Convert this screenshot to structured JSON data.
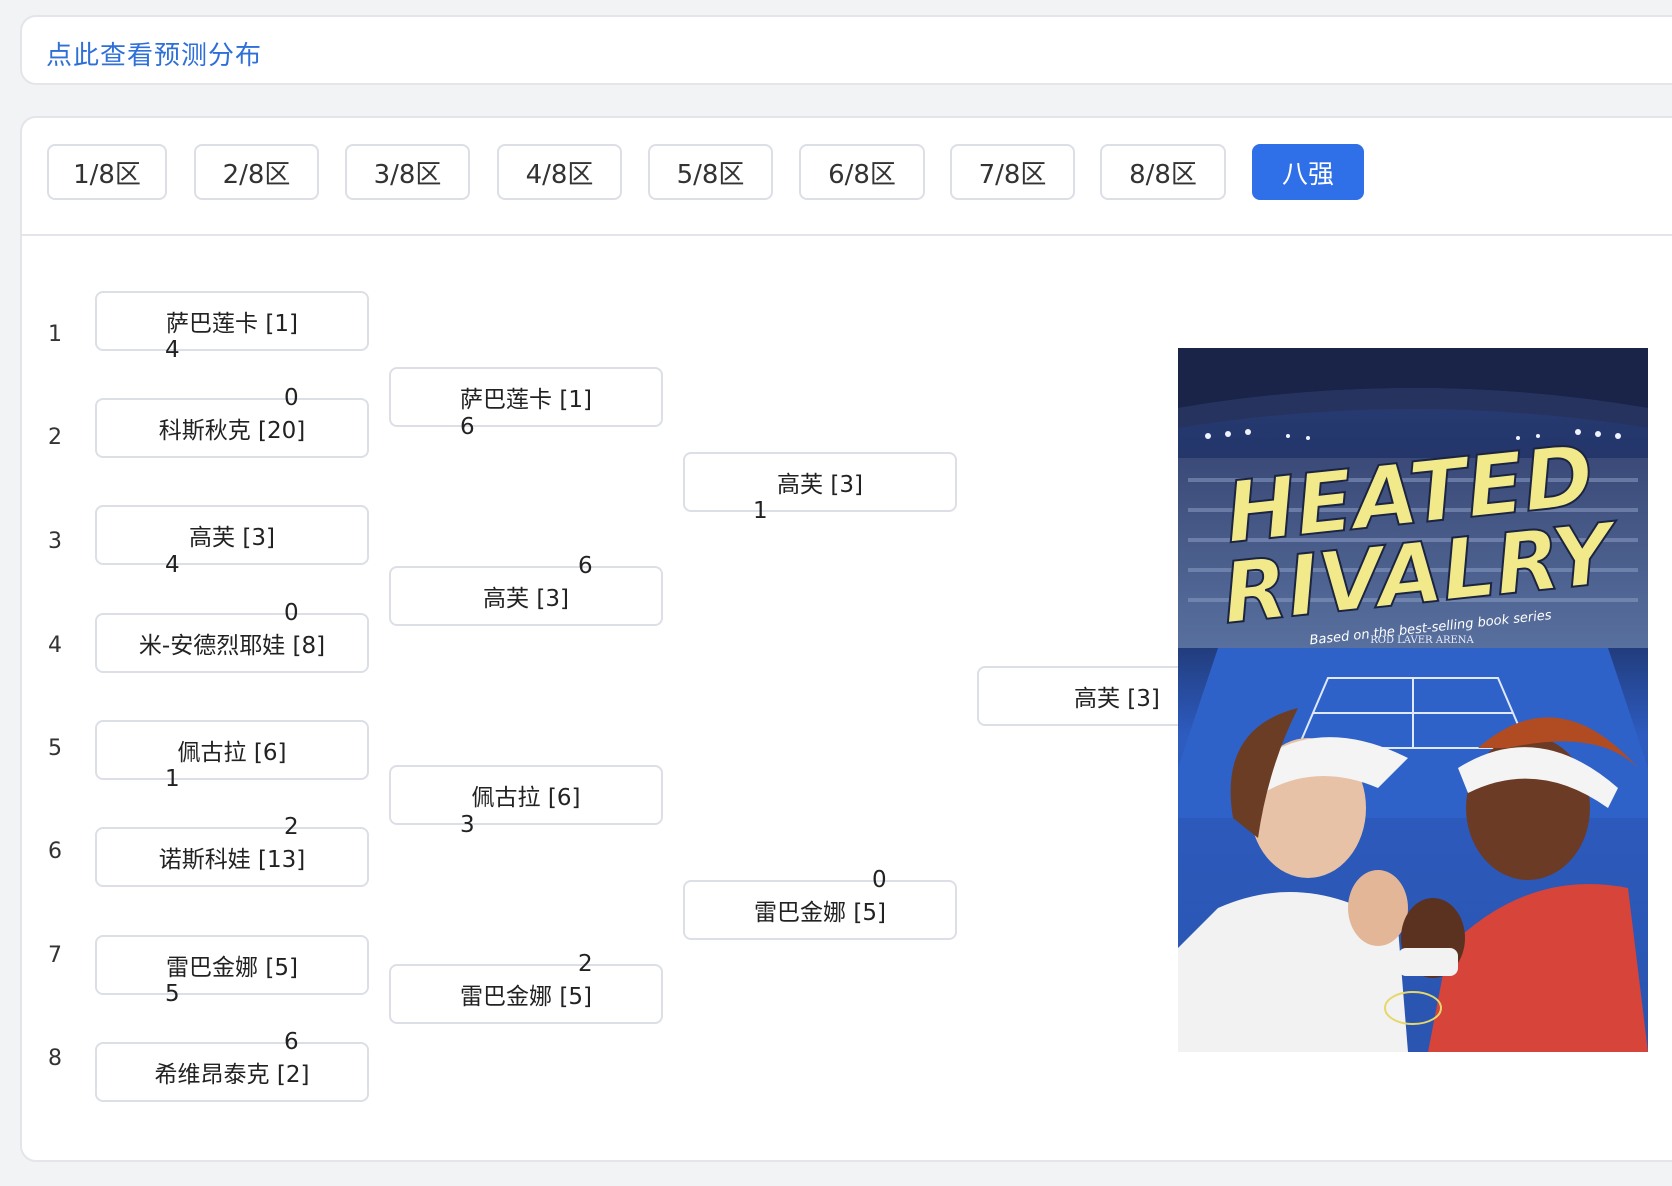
{
  "top": {
    "link_text": "点此查看预测分布"
  },
  "tabs": [
    {
      "label": "1/8区",
      "active": false
    },
    {
      "label": "2/8区",
      "active": false
    },
    {
      "label": "3/8区",
      "active": false
    },
    {
      "label": "4/8区",
      "active": false
    },
    {
      "label": "5/8区",
      "active": false
    },
    {
      "label": "6/8区",
      "active": false
    },
    {
      "label": "7/8区",
      "active": false
    },
    {
      "label": "8/8区",
      "active": false
    },
    {
      "label": "八强",
      "active": true
    }
  ],
  "rows": [
    "1",
    "2",
    "3",
    "4",
    "5",
    "6",
    "7",
    "8"
  ],
  "round1": [
    {
      "player": "萨巴莲卡 [1]",
      "score": "4"
    },
    {
      "player": "科斯秋克 [20]",
      "score": "0"
    },
    {
      "player": "高芙 [3]",
      "score": "4"
    },
    {
      "player": "米-安德烈耶娃 [8]",
      "score": "0"
    },
    {
      "player": "佩古拉 [6]",
      "score": "1"
    },
    {
      "player": "诺斯科娃 [13]",
      "score": "2"
    },
    {
      "player": "雷巴金娜 [5]",
      "score": "5"
    },
    {
      "player": "希维昂泰克 [2]",
      "score": "6"
    }
  ],
  "round2": [
    {
      "player": "萨巴莲卡 [1]",
      "score": "6"
    },
    {
      "player": "高芙 [3]",
      "score": "6"
    },
    {
      "player": "佩古拉 [6]",
      "score": "3"
    },
    {
      "player": "雷巴金娜 [5]",
      "score": "2"
    }
  ],
  "round3": [
    {
      "player": "高芙 [3]",
      "score": "1"
    },
    {
      "player": "雷巴金娜 [5]",
      "score": "0"
    }
  ],
  "final": {
    "player": "高芙 [3]"
  },
  "poster": {
    "title_line1": "HEATED",
    "title_line2": "RIVALRY",
    "tagline": "Based on the best-selling book series",
    "venue": "ROD LAVER ARENA",
    "colors": {
      "title": "#f2e98a",
      "court": "#2d5bbf",
      "sky": "#1b2a55"
    }
  }
}
